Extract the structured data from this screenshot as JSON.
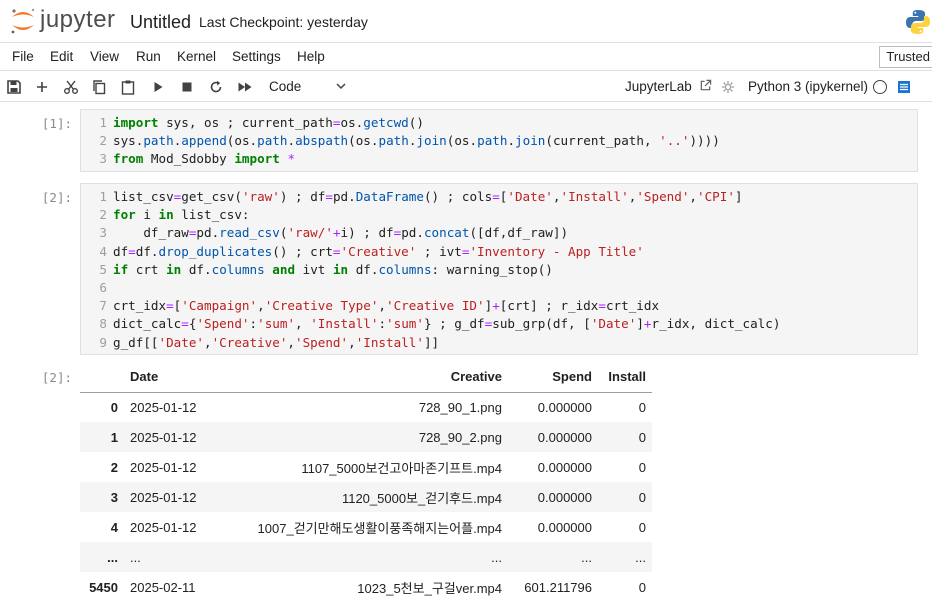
{
  "header": {
    "brand": "jupyter",
    "notebook_title": "Untitled",
    "checkpoint": "Last Checkpoint: yesterday",
    "accent_color": "#f37726"
  },
  "menubar": {
    "items": [
      "File",
      "Edit",
      "View",
      "Run",
      "Kernel",
      "Settings",
      "Help"
    ],
    "trusted": "Trusted"
  },
  "toolbar": {
    "icons": [
      "save-icon",
      "add-icon",
      "cut-icon",
      "copy-icon",
      "paste-icon",
      "run-icon",
      "stop-icon",
      "restart-icon",
      "fast-forward-icon"
    ],
    "cell_type": "Code",
    "jupyterlab_link": "JupyterLab",
    "kernel_name": "Python 3 (ipykernel)"
  },
  "cells": [
    {
      "prompt": "[1]:",
      "lines": [
        [
          "1",
          [
            [
              "kw",
              "import"
            ],
            [
              "plain",
              " sys, os ; current_path"
            ],
            [
              "op",
              "="
            ],
            [
              "plain",
              "os."
            ],
            [
              "fn",
              "getcwd"
            ],
            [
              "plain",
              "()"
            ]
          ]
        ],
        [
          "2",
          [
            [
              "plain",
              "sys."
            ],
            [
              "fn",
              "path"
            ],
            [
              "plain",
              "."
            ],
            [
              "fn",
              "append"
            ],
            [
              "plain",
              "(os."
            ],
            [
              "fn",
              "path"
            ],
            [
              "plain",
              "."
            ],
            [
              "fn",
              "abspath"
            ],
            [
              "plain",
              "(os."
            ],
            [
              "fn",
              "path"
            ],
            [
              "plain",
              "."
            ],
            [
              "fn",
              "join"
            ],
            [
              "plain",
              "(os."
            ],
            [
              "fn",
              "path"
            ],
            [
              "plain",
              "."
            ],
            [
              "fn",
              "join"
            ],
            [
              "plain",
              "(current_path, "
            ],
            [
              "str",
              "'..'"
            ],
            [
              "plain",
              "))))"
            ]
          ]
        ],
        [
          "3",
          [
            [
              "kw",
              "from"
            ],
            [
              "plain",
              " Mod_Sdobby "
            ],
            [
              "kw",
              "import"
            ],
            [
              "plain",
              " "
            ],
            [
              "op",
              "*"
            ]
          ]
        ]
      ]
    },
    {
      "prompt": "[2]:",
      "lines": [
        [
          "1",
          [
            [
              "plain",
              "list_csv"
            ],
            [
              "op",
              "="
            ],
            [
              "plain",
              "get_csv("
            ],
            [
              "str",
              "'raw'"
            ],
            [
              "plain",
              ") ; df"
            ],
            [
              "op",
              "="
            ],
            [
              "plain",
              "pd."
            ],
            [
              "fn",
              "DataFrame"
            ],
            [
              "plain",
              "() ; cols"
            ],
            [
              "op",
              "="
            ],
            [
              "plain",
              "["
            ],
            [
              "str",
              "'Date'"
            ],
            [
              "plain",
              ","
            ],
            [
              "str",
              "'Install'"
            ],
            [
              "plain",
              ","
            ],
            [
              "str",
              "'Spend'"
            ],
            [
              "plain",
              ","
            ],
            [
              "str",
              "'CPI'"
            ],
            [
              "plain",
              "]"
            ]
          ]
        ],
        [
          "2",
          [
            [
              "kw",
              "for"
            ],
            [
              "plain",
              " i "
            ],
            [
              "kw",
              "in"
            ],
            [
              "plain",
              " list_csv:"
            ]
          ]
        ],
        [
          "3",
          [
            [
              "plain",
              "    df_raw"
            ],
            [
              "op",
              "="
            ],
            [
              "plain",
              "pd."
            ],
            [
              "fn",
              "read_csv"
            ],
            [
              "plain",
              "("
            ],
            [
              "str",
              "'raw/'"
            ],
            [
              "op",
              "+"
            ],
            [
              "plain",
              "i) ; df"
            ],
            [
              "op",
              "="
            ],
            [
              "plain",
              "pd."
            ],
            [
              "fn",
              "concat"
            ],
            [
              "plain",
              "([df,df_raw])"
            ]
          ]
        ],
        [
          "4",
          [
            [
              "plain",
              "df"
            ],
            [
              "op",
              "="
            ],
            [
              "plain",
              "df."
            ],
            [
              "fn",
              "drop_duplicates"
            ],
            [
              "plain",
              "() ; crt"
            ],
            [
              "op",
              "="
            ],
            [
              "str",
              "'Creative'"
            ],
            [
              "plain",
              " ; ivt"
            ],
            [
              "op",
              "="
            ],
            [
              "str",
              "'Inventory - App Title'"
            ]
          ]
        ],
        [
          "5",
          [
            [
              "kw",
              "if"
            ],
            [
              "plain",
              " crt "
            ],
            [
              "kw",
              "in"
            ],
            [
              "plain",
              " df."
            ],
            [
              "fn",
              "columns"
            ],
            [
              "plain",
              " "
            ],
            [
              "kw",
              "and"
            ],
            [
              "plain",
              " ivt "
            ],
            [
              "kw",
              "in"
            ],
            [
              "plain",
              " df."
            ],
            [
              "fn",
              "columns"
            ],
            [
              "plain",
              ": warning_stop()"
            ]
          ]
        ],
        [
          "6",
          []
        ],
        [
          "7",
          [
            [
              "plain",
              "crt_idx"
            ],
            [
              "op",
              "="
            ],
            [
              "plain",
              "["
            ],
            [
              "str",
              "'Campaign'"
            ],
            [
              "plain",
              ","
            ],
            [
              "str",
              "'Creative Type'"
            ],
            [
              "plain",
              ","
            ],
            [
              "str",
              "'Creative ID'"
            ],
            [
              "plain",
              "]"
            ],
            [
              "op",
              "+"
            ],
            [
              "plain",
              "[crt] ; r_idx"
            ],
            [
              "op",
              "="
            ],
            [
              "plain",
              "crt_idx"
            ]
          ]
        ],
        [
          "8",
          [
            [
              "plain",
              "dict_calc"
            ],
            [
              "op",
              "="
            ],
            [
              "plain",
              "{"
            ],
            [
              "str",
              "'Spend'"
            ],
            [
              "plain",
              ":"
            ],
            [
              "str",
              "'sum'"
            ],
            [
              "plain",
              ", "
            ],
            [
              "str",
              "'Install'"
            ],
            [
              "plain",
              ":"
            ],
            [
              "str",
              "'sum'"
            ],
            [
              "plain",
              "} ; g_df"
            ],
            [
              "op",
              "="
            ],
            [
              "plain",
              "sub_grp(df, ["
            ],
            [
              "str",
              "'Date'"
            ],
            [
              "plain",
              "]"
            ],
            [
              "op",
              "+"
            ],
            [
              "plain",
              "r_idx, dict_calc)"
            ]
          ]
        ],
        [
          "9",
          [
            [
              "plain",
              "g_df[["
            ],
            [
              "str",
              "'Date'"
            ],
            [
              "plain",
              ","
            ],
            [
              "str",
              "'Creative'"
            ],
            [
              "plain",
              ","
            ],
            [
              "str",
              "'Spend'"
            ],
            [
              "plain",
              ","
            ],
            [
              "str",
              "'Install'"
            ],
            [
              "plain",
              "]]"
            ]
          ]
        ]
      ]
    }
  ],
  "output": {
    "prompt": "[2]:",
    "columns": [
      "",
      "Date",
      "Creative",
      "Spend",
      "Install"
    ],
    "rows": [
      [
        "0",
        "2025-01-12",
        "728_90_1.png",
        "0.000000",
        "0"
      ],
      [
        "1",
        "2025-01-12",
        "728_90_2.png",
        "0.000000",
        "0"
      ],
      [
        "2",
        "2025-01-12",
        "1107_5000보건고아마존기프트.mp4",
        "0.000000",
        "0"
      ],
      [
        "3",
        "2025-01-12",
        "1120_5000보_걷기후드.mp4",
        "0.000000",
        "0"
      ],
      [
        "4",
        "2025-01-12",
        "1007_걷기만해도생활이풍족해지는어플.mp4",
        "0.000000",
        "0"
      ],
      [
        "...",
        "...",
        "...",
        "...",
        "..."
      ],
      [
        "5450",
        "2025-02-11",
        "1023_5천보_구걸ver.mp4",
        "601.211796",
        "0"
      ]
    ]
  }
}
